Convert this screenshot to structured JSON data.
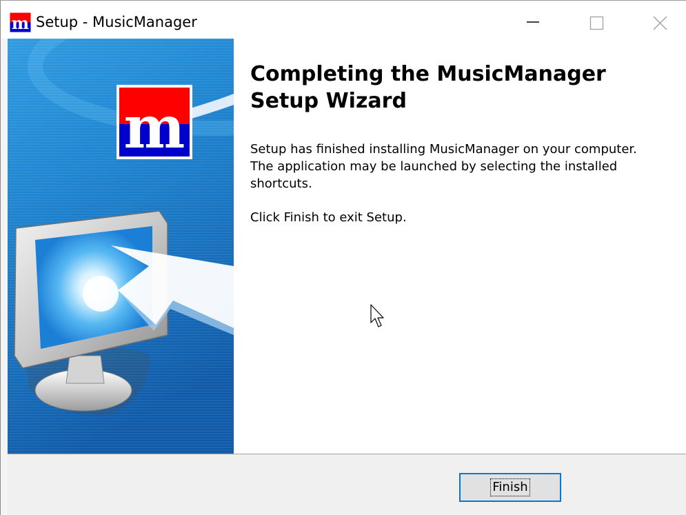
{
  "window": {
    "title": "Setup - MusicManager",
    "app_icon": "musicmanager-logo-icon",
    "controls": [
      "minimize-icon",
      "maximize-icon",
      "close-icon"
    ]
  },
  "side_panel": {
    "image": "wizard-banner-image",
    "logo_icon": "musicmanager-m-logo",
    "illustration": "monitor-with-arrow-illustration"
  },
  "content": {
    "heading": "Completing the MusicManager\nSetup Wizard",
    "body": "Setup has finished installing MusicManager on your computer. The application may be launched by selecting the installed shortcuts.",
    "exit_instruction": "Click Finish to exit Setup."
  },
  "buttons": {
    "finish_label": "Finish"
  },
  "colors": {
    "logo_red": "#ff0000",
    "logo_blue": "#0000cc",
    "banner_blue": "#1a7fd0",
    "focus_border": "#0078d7",
    "button_face": "#e1e1e1"
  }
}
